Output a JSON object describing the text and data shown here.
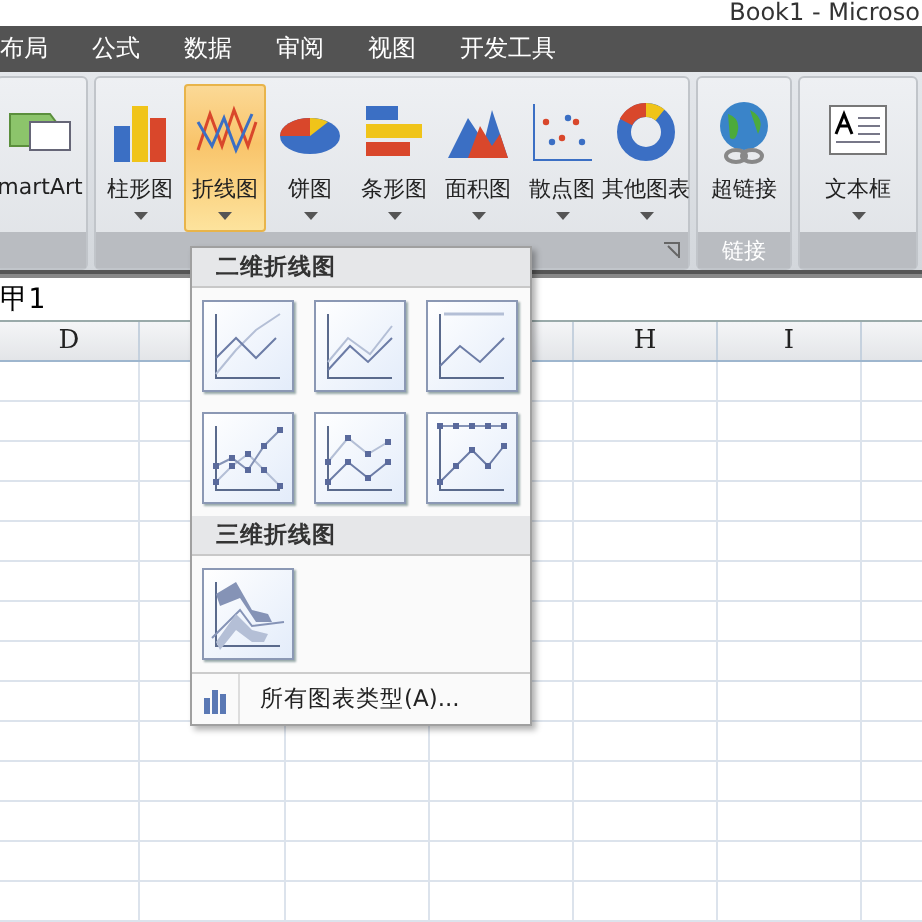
{
  "window": {
    "title": "Book1 - Microso"
  },
  "tabs": [
    {
      "label": "布局",
      "selected": false
    },
    {
      "label": "公式",
      "selected": false
    },
    {
      "label": "数据",
      "selected": false
    },
    {
      "label": "审阅",
      "selected": false
    },
    {
      "label": "视图",
      "selected": false
    },
    {
      "label": "开发工具",
      "selected": false
    }
  ],
  "ribbon": {
    "groups": [
      {
        "buttons": [
          {
            "label": "martArt",
            "kind": "smartart",
            "selected": false,
            "dropdown": false
          }
        ]
      },
      {
        "buttons": [
          {
            "label": "柱形图",
            "kind": "column",
            "selected": false,
            "dropdown": true
          },
          {
            "label": "折线图",
            "kind": "line",
            "selected": true,
            "dropdown": true
          },
          {
            "label": "饼图",
            "kind": "pie",
            "selected": false,
            "dropdown": true
          },
          {
            "label": "条形图",
            "kind": "bar",
            "selected": false,
            "dropdown": true
          },
          {
            "label": "面积图",
            "kind": "area",
            "selected": false,
            "dropdown": true
          },
          {
            "label": "散点图",
            "kind": "scatter",
            "selected": false,
            "dropdown": true
          },
          {
            "label": "其他图表",
            "kind": "other",
            "selected": false,
            "dropdown": true
          }
        ],
        "launcher": true
      },
      {
        "label": "链接",
        "buttons": [
          {
            "label": "超链接",
            "kind": "hyperlink",
            "selected": false,
            "dropdown": false
          }
        ]
      },
      {
        "buttons": [
          {
            "label": "文本框",
            "kind": "textbox",
            "selected": false,
            "dropdown": true
          }
        ]
      }
    ]
  },
  "name_box": "甲1",
  "column_headers": [
    {
      "label": "D"
    },
    {
      "label": "H"
    },
    {
      "label": "I"
    }
  ],
  "menu": {
    "sections": [
      {
        "title": "二维折线图",
        "items": [
          {
            "kind": "line"
          },
          {
            "kind": "stacked"
          },
          {
            "kind": "percent"
          },
          {
            "kind": "line-markers"
          },
          {
            "kind": "stacked-markers"
          },
          {
            "kind": "percent-markers"
          }
        ]
      },
      {
        "title": "三维折线图",
        "items": [
          {
            "kind": "line-3d"
          }
        ]
      }
    ],
    "footer": "所有图表类型(A)..."
  }
}
